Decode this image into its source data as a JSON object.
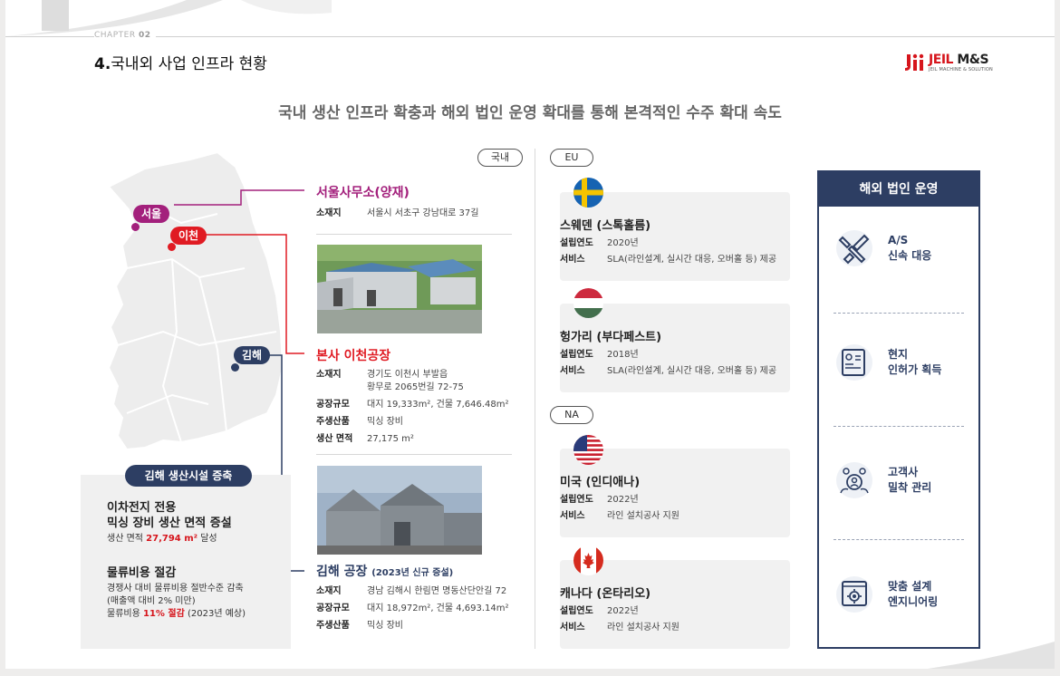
{
  "header": {
    "chapter_prefix": "CHAPTER",
    "chapter_num": "02",
    "title_num": "4.",
    "title_text": "국내외 사업 인프라 현황",
    "logo_main": "JEIL",
    "logo_accent": "M&S",
    "logo_sub": "JEIL MACHINE & SOLUTION"
  },
  "subtitle": "국내 생산 인프라 확충과 해외 법인 운영 확대를 통해 본격적인 수주 확대 속도",
  "map": {
    "labels": {
      "seoul": "서울",
      "icheon": "이천",
      "gimhae": "김해"
    },
    "colors": {
      "seoul": "#a3207c",
      "icheon": "#e01b23",
      "gimhae": "#2d3e63"
    }
  },
  "gimhae_box": {
    "pill": "김해 생산시설 증축",
    "block1_title_l1": "이차전지 전용",
    "block1_title_l2": "믹싱 장비 생산 면적 증설",
    "block1_sub_pre": "생산 면적 ",
    "block1_sub_red": "27,794 m²",
    "block1_sub_post": " 달성",
    "block2_title": "물류비용 절감",
    "block2_sub1": "경쟁사 대비 물류비용 절반수준 감축",
    "block2_sub2": "(매출액 대비 2% 미만)",
    "block2_sub3_pre": "물류비용 ",
    "block2_sub3_red": "11% 절감",
    "block2_sub3_post": " (2023년 예상)"
  },
  "domestic": {
    "pill": "국내",
    "seoul_office": {
      "title": "서울사무소(양재)",
      "addr_k": "소재지",
      "addr_v": "서울시 서초구 강남대로 37길"
    },
    "icheon": {
      "title": "본사 이천공장",
      "rows": [
        {
          "k": "소재지",
          "v": "경기도 이천시 부발읍"
        },
        {
          "k": "",
          "v": "황무로 2065번길 72-75"
        },
        {
          "k": "공장규모",
          "v": "대지 19,333m², 건물 7,646.48m²"
        },
        {
          "k": "주생산품",
          "v": "믹싱 장비"
        },
        {
          "k": "생산 면적",
          "v": "27,175 m²"
        }
      ]
    },
    "gimhae": {
      "title": "김해 공장",
      "title_note": "(2023년 신규 증설)",
      "rows": [
        {
          "k": "소재지",
          "v": "경남 김해시 한림면 명동산단안길 72"
        },
        {
          "k": "공장규모",
          "v": "대지 18,972m², 건물 4,693.14m²"
        },
        {
          "k": "주생산품",
          "v": "믹싱 장비"
        }
      ]
    }
  },
  "overseas": {
    "eu_pill": "EU",
    "na_pill": "NA",
    "k_year": "설립연도",
    "k_service": "서비스",
    "cards": [
      {
        "title": "스웨덴 (스톡홀름)",
        "year": "2020년",
        "service": "SLA(라인설계, 실시간 대응, 오버홀 등) 제공",
        "flag": "sweden-flag-icon"
      },
      {
        "title": "헝가리 (부다페스트)",
        "year": "2018년",
        "service": "SLA(라인설계, 실시간 대응, 오버홀 등) 제공",
        "flag": "hungary-flag-icon"
      },
      {
        "title": "미국 (인디애나)",
        "year": "2022년",
        "service": "라인 설치공사 지원",
        "flag": "usa-flag-icon"
      },
      {
        "title": "캐나다 (온타리오)",
        "year": "2022년",
        "service": "라인 설치공사 지원",
        "flag": "canada-flag-icon"
      }
    ]
  },
  "ops": {
    "title": "해외 법인 운영",
    "items": [
      {
        "l1": "A/S",
        "l2": "신속 대응",
        "icon": "tools-icon"
      },
      {
        "l1": "현지",
        "l2": "인허가 획득",
        "icon": "certificate-icon"
      },
      {
        "l1": "고객사",
        "l2": "밀착 관리",
        "icon": "customer-group-icon"
      },
      {
        "l1": "맞춤 설계",
        "l2": "엔지니어링",
        "icon": "engineering-gear-icon"
      }
    ]
  }
}
